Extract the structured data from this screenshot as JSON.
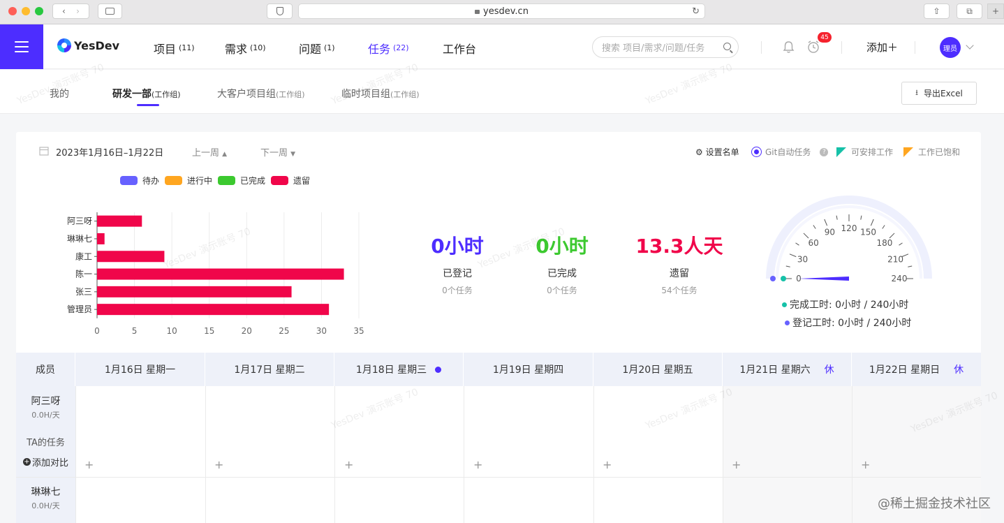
{
  "browser": {
    "url": "yesdev.cn"
  },
  "header": {
    "logo_text": "YesDev",
    "nav": [
      {
        "label": "项目",
        "count": "(11)"
      },
      {
        "label": "需求",
        "count": "(10)"
      },
      {
        "label": "问题",
        "count": "(1)"
      },
      {
        "label": "任务",
        "count": "(22)"
      },
      {
        "label": "工作台",
        "count": ""
      }
    ],
    "search_placeholder": "搜索 项目/需求/问题/任务",
    "notification_badge": "45",
    "add_label": "添加＋",
    "avatar_label": "理员"
  },
  "subnav": {
    "tabs": [
      {
        "label": "我的",
        "tag": ""
      },
      {
        "label": "研发一部",
        "tag": "(工作组)"
      },
      {
        "label": "大客户项目组",
        "tag": "(工作组)"
      },
      {
        "label": "临时项目组",
        "tag": "(工作组)"
      }
    ],
    "export_label": "导出Excel"
  },
  "toolbar": {
    "date_range": "2023年1月16日–1月22日",
    "prev_week": "上一周",
    "next_week": "下一周",
    "settings_list": "设置名单",
    "git_auto_task": "Git自动任务",
    "schedulable": "可安排工作",
    "saturated": "工作已饱和"
  },
  "legend": [
    {
      "label": "待办",
      "color": "#6761ff"
    },
    {
      "label": "进行中",
      "color": "#ffa620"
    },
    {
      "label": "已完成",
      "color": "#3cc92f"
    },
    {
      "label": "遗留",
      "color": "#f0064a"
    }
  ],
  "chart_data": {
    "type": "bar",
    "orientation": "horizontal",
    "categories": [
      "阿三呀",
      "琳琳七",
      "康工",
      "陈一",
      "张三",
      "管理员"
    ],
    "series": [
      {
        "name": "遗留",
        "values": [
          6,
          1,
          9,
          33,
          26,
          31
        ],
        "color": "#f0064a"
      }
    ],
    "xlim": [
      0,
      35
    ],
    "xticks": [
      "0",
      "5",
      "10",
      "15",
      "20",
      "25",
      "30",
      "35"
    ],
    "grid": true
  },
  "stats": [
    {
      "value": "0小时",
      "label": "已登记",
      "sub": "0个任务",
      "color": "#4d2dff"
    },
    {
      "value": "0小时",
      "label": "已完成",
      "sub": "0个任务",
      "color": "#3cc92f"
    },
    {
      "value": "13.3人天",
      "label": "遗留",
      "sub": "54个任务",
      "color": "#f0064a"
    }
  ],
  "gauge": {
    "ticks": [
      "0",
      "30",
      "60",
      "90",
      "120",
      "150",
      "180",
      "210",
      "240"
    ],
    "max": 240,
    "completed_hours": 0,
    "logged_hours": 0,
    "completed_label": "完成工时: 0小时 / 240小时",
    "logged_label": "登记工时: 0小时 / 240小时"
  },
  "grid": {
    "member_header": "成员",
    "days": [
      {
        "label": "1月16日  星期一",
        "rest": "",
        "today": false
      },
      {
        "label": "1月17日  星期二",
        "rest": "",
        "today": false
      },
      {
        "label": "1月18日  星期三",
        "rest": "",
        "today": true
      },
      {
        "label": "1月19日  星期四",
        "rest": "",
        "today": false
      },
      {
        "label": "1月20日  星期五",
        "rest": "",
        "today": false
      },
      {
        "label": "1月21日  星期六",
        "rest": "休",
        "today": false
      },
      {
        "label": "1月22日  星期日",
        "rest": "休",
        "today": false
      }
    ],
    "members": [
      {
        "name": "阿三呀",
        "rate": "0.0H/天",
        "tasks_label": "TA的任务",
        "compare_label": "添加对比"
      },
      {
        "name": "琳琳七",
        "rate": "0.0H/天"
      }
    ],
    "add_symbol": "+"
  },
  "watermark": "YesDev 演示账号 70",
  "footer_brand": "@稀土掘金技术社区"
}
